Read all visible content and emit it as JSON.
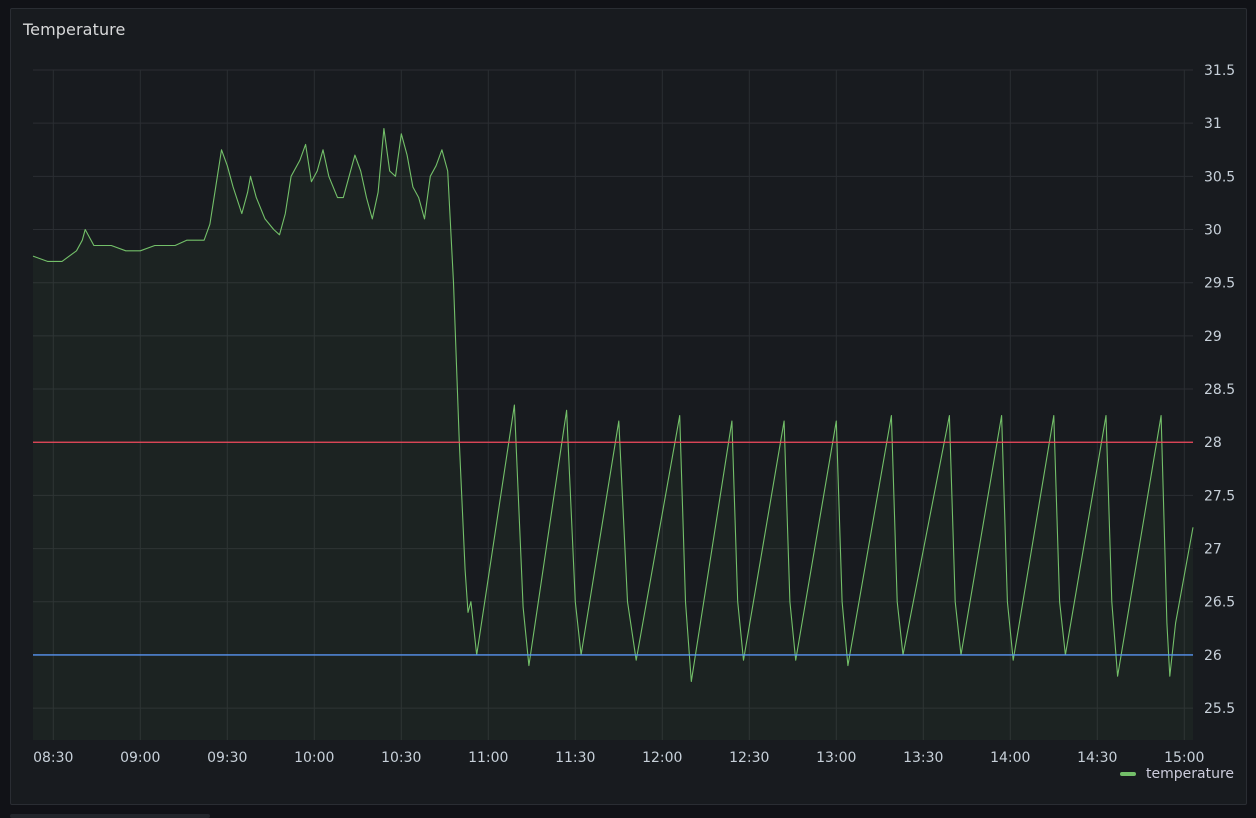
{
  "panel": {
    "title": "Temperature"
  },
  "colors": {
    "background": "#111217",
    "panel": "#181b1f",
    "series": "#73bf69",
    "threshold_high": "#f2495c",
    "threshold_low": "#5794f2",
    "grid": "#2b2e33",
    "tick_text": "#c7d0d9"
  },
  "chart_data": {
    "type": "line",
    "title": "Temperature",
    "xlabel": "",
    "ylabel": "",
    "x_range": [
      "08:23",
      "15:03"
    ],
    "ylim": [
      25.2,
      31.5
    ],
    "x_ticks": [
      "08:30",
      "09:00",
      "09:30",
      "10:00",
      "10:30",
      "11:00",
      "11:30",
      "12:00",
      "12:30",
      "13:00",
      "13:30",
      "14:00",
      "14:30",
      "15:00"
    ],
    "y_ticks": [
      25.5,
      26,
      26.5,
      27,
      27.5,
      28,
      28.5,
      29,
      29.5,
      30,
      30.5,
      31,
      31.5
    ],
    "grid": true,
    "legend": "bottom-right",
    "thresholds": [
      {
        "value": 28,
        "color": "#f2495c"
      },
      {
        "value": 26,
        "color": "#5794f2"
      }
    ],
    "series": [
      {
        "name": "temperature",
        "color": "#73bf69",
        "points": [
          [
            "08:23",
            29.75
          ],
          [
            "08:28",
            29.7
          ],
          [
            "08:33",
            29.7
          ],
          [
            "08:38",
            29.8
          ],
          [
            "08:40",
            29.9
          ],
          [
            "08:41",
            30.0
          ],
          [
            "08:44",
            29.85
          ],
          [
            "08:50",
            29.85
          ],
          [
            "08:55",
            29.8
          ],
          [
            "09:00",
            29.8
          ],
          [
            "09:05",
            29.85
          ],
          [
            "09:12",
            29.85
          ],
          [
            "09:16",
            29.9
          ],
          [
            "09:22",
            29.9
          ],
          [
            "09:24",
            30.05
          ],
          [
            "09:26",
            30.4
          ],
          [
            "09:28",
            30.75
          ],
          [
            "09:30",
            30.6
          ],
          [
            "09:32",
            30.4
          ],
          [
            "09:35",
            30.15
          ],
          [
            "09:37",
            30.35
          ],
          [
            "09:38",
            30.5
          ],
          [
            "09:40",
            30.3
          ],
          [
            "09:43",
            30.1
          ],
          [
            "09:46",
            30.0
          ],
          [
            "09:48",
            29.95
          ],
          [
            "09:50",
            30.15
          ],
          [
            "09:52",
            30.5
          ],
          [
            "09:55",
            30.65
          ],
          [
            "09:57",
            30.8
          ],
          [
            "09:59",
            30.45
          ],
          [
            "10:01",
            30.55
          ],
          [
            "10:03",
            30.75
          ],
          [
            "10:05",
            30.5
          ],
          [
            "10:08",
            30.3
          ],
          [
            "10:10",
            30.3
          ],
          [
            "10:12",
            30.5
          ],
          [
            "10:14",
            30.7
          ],
          [
            "10:16",
            30.55
          ],
          [
            "10:18",
            30.3
          ],
          [
            "10:20",
            30.1
          ],
          [
            "10:22",
            30.35
          ],
          [
            "10:24",
            30.95
          ],
          [
            "10:26",
            30.55
          ],
          [
            "10:28",
            30.5
          ],
          [
            "10:30",
            30.9
          ],
          [
            "10:32",
            30.7
          ],
          [
            "10:34",
            30.4
          ],
          [
            "10:36",
            30.3
          ],
          [
            "10:38",
            30.1
          ],
          [
            "10:40",
            30.5
          ],
          [
            "10:42",
            30.6
          ],
          [
            "10:44",
            30.75
          ],
          [
            "10:46",
            30.55
          ],
          [
            "10:48",
            29.5
          ],
          [
            "10:50",
            28.0
          ],
          [
            "10:52",
            26.8
          ],
          [
            "10:53",
            26.4
          ],
          [
            "10:54",
            26.5
          ],
          [
            "10:56",
            26.0
          ],
          [
            "11:09",
            28.35
          ],
          [
            "11:12",
            26.45
          ],
          [
            "11:14",
            25.9
          ],
          [
            "11:27",
            28.3
          ],
          [
            "11:30",
            26.5
          ],
          [
            "11:32",
            26.0
          ],
          [
            "11:45",
            28.2
          ],
          [
            "11:48",
            26.5
          ],
          [
            "11:51",
            25.95
          ],
          [
            "12:06",
            28.25
          ],
          [
            "12:08",
            26.5
          ],
          [
            "12:10",
            25.75
          ],
          [
            "12:24",
            28.2
          ],
          [
            "12:26",
            26.5
          ],
          [
            "12:28",
            25.95
          ],
          [
            "12:42",
            28.2
          ],
          [
            "12:44",
            26.5
          ],
          [
            "12:46",
            25.95
          ],
          [
            "13:00",
            28.2
          ],
          [
            "13:02",
            26.5
          ],
          [
            "13:04",
            25.9
          ],
          [
            "13:19",
            28.25
          ],
          [
            "13:21",
            26.5
          ],
          [
            "13:23",
            26.0
          ],
          [
            "13:39",
            28.25
          ],
          [
            "13:41",
            26.5
          ],
          [
            "13:43",
            26.0
          ],
          [
            "13:57",
            28.25
          ],
          [
            "13:59",
            26.5
          ],
          [
            "14:01",
            25.95
          ],
          [
            "14:15",
            28.25
          ],
          [
            "14:17",
            26.5
          ],
          [
            "14:19",
            26.0
          ],
          [
            "14:33",
            28.25
          ],
          [
            "14:35",
            26.5
          ],
          [
            "14:37",
            25.8
          ],
          [
            "14:52",
            28.25
          ],
          [
            "14:54",
            26.3
          ],
          [
            "14:55",
            25.8
          ],
          [
            "14:57",
            26.3
          ],
          [
            "15:03",
            27.2
          ]
        ]
      }
    ]
  }
}
